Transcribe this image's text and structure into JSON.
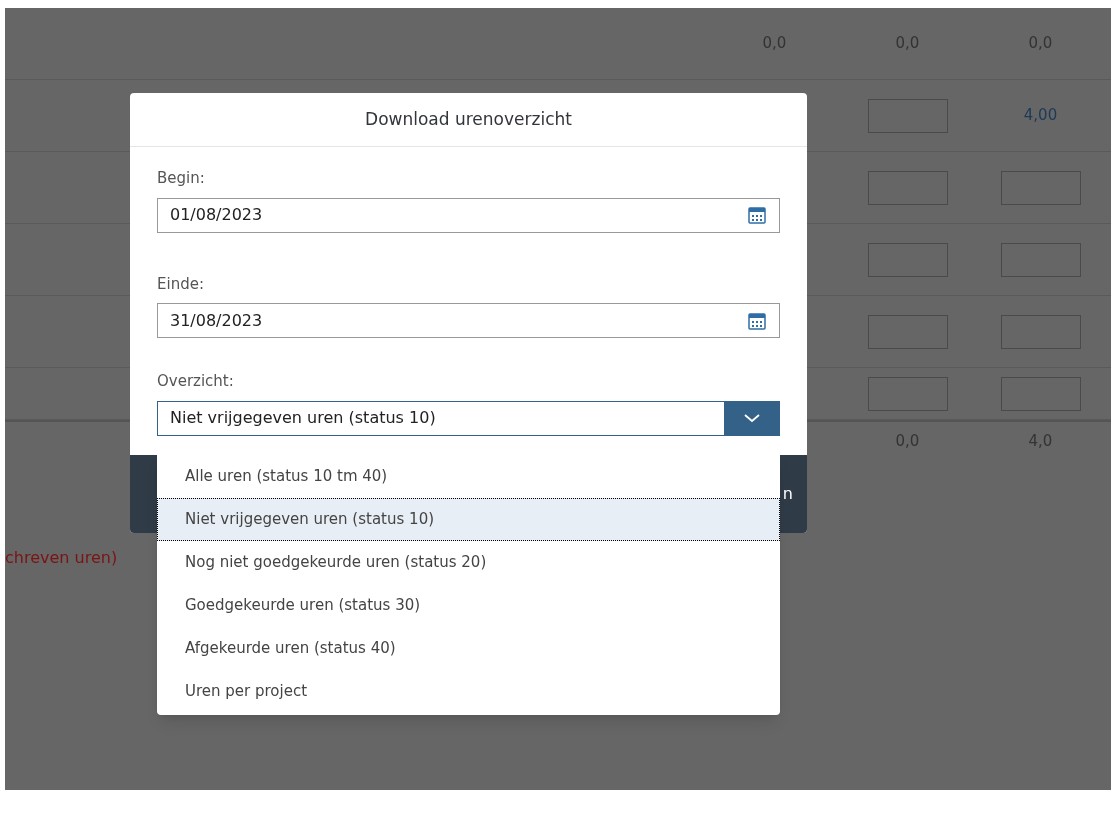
{
  "table": {
    "rows": [
      {
        "cells": [
          {
            "kind": "text",
            "value": "0,0"
          },
          {
            "kind": "text",
            "value": "0,0"
          },
          {
            "kind": "text",
            "value": "0,0"
          }
        ]
      },
      {
        "cells": [
          {
            "kind": "empty"
          },
          {
            "kind": "input"
          },
          {
            "kind": "link",
            "value": "4,00"
          }
        ]
      },
      {
        "cells": [
          {
            "kind": "empty"
          },
          {
            "kind": "input"
          },
          {
            "kind": "input"
          }
        ]
      },
      {
        "cells": [
          {
            "kind": "empty"
          },
          {
            "kind": "input"
          },
          {
            "kind": "input"
          }
        ]
      },
      {
        "cells": [
          {
            "kind": "empty"
          },
          {
            "kind": "input"
          },
          {
            "kind": "input"
          }
        ]
      },
      {
        "cells": [
          {
            "kind": "empty"
          },
          {
            "kind": "input"
          },
          {
            "kind": "input"
          }
        ]
      }
    ],
    "totals": [
      {
        "kind": "empty"
      },
      {
        "kind": "text",
        "value": "0,0"
      },
      {
        "kind": "text",
        "value": "4,0"
      }
    ]
  },
  "note": "chreven uren)",
  "dialog": {
    "title": "Download urenoverzicht",
    "fields": [
      {
        "label": "Begin:",
        "value": "01/08/2023"
      },
      {
        "label": "Einde:",
        "value": "31/08/2023"
      }
    ],
    "select": {
      "label": "Overzicht:",
      "value": "Niet vrijgegeven uren (status 10)",
      "expanded": true,
      "options": [
        {
          "label": "Alle uren (status 10 tm 40)",
          "selected": false
        },
        {
          "label": "Niet vrijgegeven uren (status 10)",
          "selected": true
        },
        {
          "label": "Nog niet goedgekeurde uren (status 20)",
          "selected": false
        },
        {
          "label": "Goedgekeurde uren (status 30)",
          "selected": false
        },
        {
          "label": "Afgekeurde uren (status 40)",
          "selected": false
        },
        {
          "label": "Uren per project",
          "selected": false
        }
      ]
    },
    "footer_button": "n"
  }
}
